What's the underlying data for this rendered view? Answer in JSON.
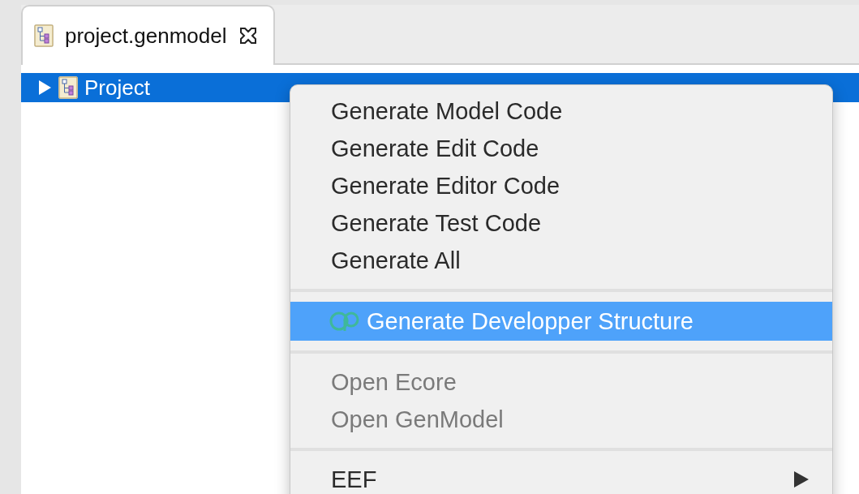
{
  "tabs": [
    {
      "label": "project.genmodel",
      "selected": true
    }
  ],
  "tree": [
    {
      "label": "Project",
      "selected": true,
      "expanded": false
    }
  ],
  "context_menu": [
    {
      "kind": "item",
      "label": "Generate Model Code",
      "disabled": false,
      "selected": false
    },
    {
      "kind": "item",
      "label": "Generate Edit Code",
      "disabled": false,
      "selected": false
    },
    {
      "kind": "item",
      "label": "Generate Editor Code",
      "disabled": false,
      "selected": false
    },
    {
      "kind": "item",
      "label": "Generate Test Code",
      "disabled": false,
      "selected": false
    },
    {
      "kind": "item",
      "label": "Generate All",
      "disabled": false,
      "selected": false
    },
    {
      "kind": "separator"
    },
    {
      "kind": "icon-item",
      "label": "Generate Developper Structure",
      "disabled": false,
      "selected": true
    },
    {
      "kind": "separator"
    },
    {
      "kind": "item",
      "label": "Open Ecore",
      "disabled": true,
      "selected": false
    },
    {
      "kind": "item",
      "label": "Open GenModel",
      "disabled": true,
      "selected": false
    },
    {
      "kind": "separator"
    },
    {
      "kind": "submenu",
      "label": "EEF",
      "disabled": false,
      "selected": false
    }
  ]
}
